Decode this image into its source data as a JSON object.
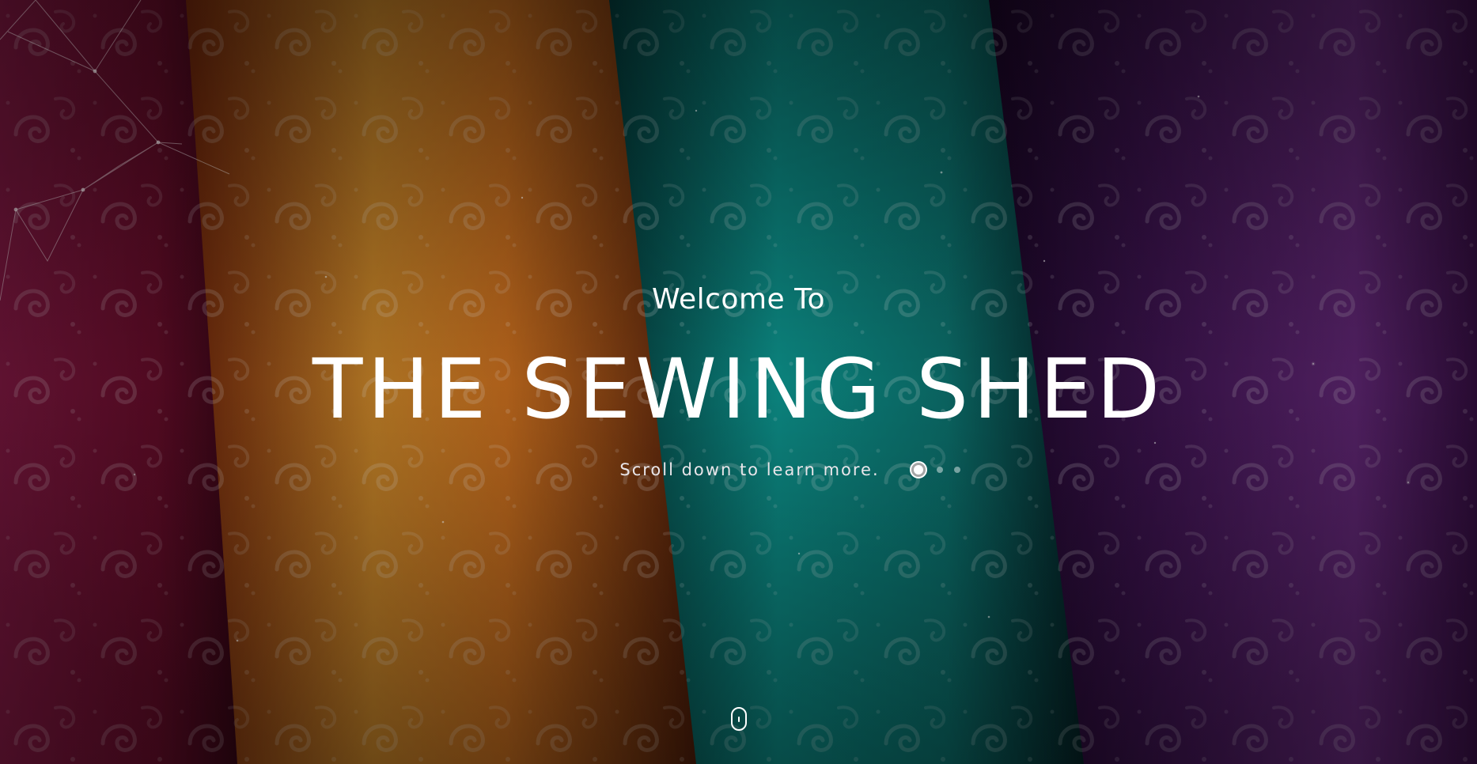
{
  "hero": {
    "welcome": "Welcome To",
    "title": "THE SEWING SHED",
    "subtitle": "Scroll down to learn more."
  },
  "slider": {
    "slide_count": 3,
    "active_index": 0
  },
  "scroll_indicator": {
    "icon": "mouse-scroll-icon"
  },
  "colors": {
    "text": "#ffffff",
    "fabric_magenta": "#7a1038",
    "fabric_orange": "#c9701c",
    "fabric_teal": "#0f7f7a",
    "fabric_purple": "#5a1f6e"
  }
}
